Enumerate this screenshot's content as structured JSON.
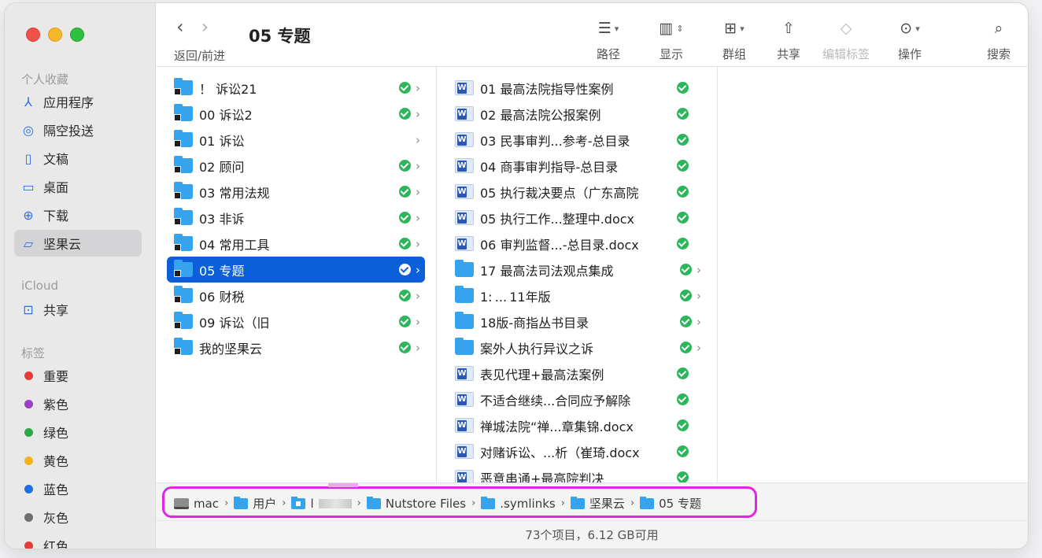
{
  "window": {
    "title": "05 专题",
    "nav_label": "返回/前进"
  },
  "sidebar": {
    "favorites_header": "个人收藏",
    "favorites": [
      {
        "label": "应用程序",
        "icon": "apps-icon"
      },
      {
        "label": "隔空投送",
        "icon": "airdrop-icon"
      },
      {
        "label": "文稿",
        "icon": "document-icon"
      },
      {
        "label": "桌面",
        "icon": "desktop-icon"
      },
      {
        "label": "下载",
        "icon": "download-icon"
      },
      {
        "label": "坚果云",
        "icon": "folder-icon",
        "selected": true
      }
    ],
    "icloud_header": "iCloud",
    "icloud": [
      {
        "label": "共享",
        "icon": "shared-folder-icon"
      }
    ],
    "tags_header": "标签",
    "tags": [
      {
        "label": "重要",
        "color": "#e63b3b"
      },
      {
        "label": "紫色",
        "color": "#9b3fc6"
      },
      {
        "label": "绿色",
        "color": "#2aa84a"
      },
      {
        "label": "黄色",
        "color": "#f1b21c"
      },
      {
        "label": "蓝色",
        "color": "#1e6fe3"
      },
      {
        "label": "灰色",
        "color": "#6e6e70"
      },
      {
        "label": "红色",
        "color": "#e63b3b"
      }
    ]
  },
  "toolbar": {
    "path": "路径",
    "view": "显示",
    "group": "群组",
    "share": "共享",
    "edit_tags": "编辑标签",
    "action": "操作",
    "search": "搜索"
  },
  "column1": [
    {
      "name": "！ 诉讼21",
      "synced": true
    },
    {
      "name": "00 诉讼2",
      "synced": true
    },
    {
      "name": "01 诉讼",
      "synced": false
    },
    {
      "name": "02 顾问",
      "synced": true
    },
    {
      "name": "03 常用法规",
      "synced": true
    },
    {
      "name": "03 非诉",
      "synced": true
    },
    {
      "name": "04 常用工具",
      "synced": true
    },
    {
      "name": "05 专题",
      "synced": true,
      "selected": true
    },
    {
      "name": "06 财税",
      "synced": true
    },
    {
      "name": "09 诉讼（旧",
      "synced": true
    },
    {
      "name": "我的坚果云",
      "synced": true
    }
  ],
  "column2": [
    {
      "name": "01 最高法院指导性案例",
      "kind": "doc"
    },
    {
      "name": "02 最高法院公报案例",
      "kind": "doc"
    },
    {
      "name": "03 民事审判...参考-总目录",
      "kind": "doc"
    },
    {
      "name": "04 商事审判指导-总目录",
      "kind": "doc"
    },
    {
      "name": "05 执行裁决要点（广东高院",
      "kind": "doc"
    },
    {
      "name": "05 执行工作...整理中.docx",
      "kind": "doc"
    },
    {
      "name": "06 审判监督...-总目录.docx",
      "kind": "doc"
    },
    {
      "name": "17 最高法司法观点集成",
      "kind": "folder"
    },
    {
      "name": "1: ... 11年版",
      "kind": "folder"
    },
    {
      "name": "18版-商指丛书目录",
      "kind": "folder"
    },
    {
      "name": "案外人执行异议之诉",
      "kind": "folder"
    },
    {
      "name": "表见代理+最高法案例",
      "kind": "doc"
    },
    {
      "name": "不适合继续...合同应予解除",
      "kind": "doc"
    },
    {
      "name": "禅城法院“禅...章集锦.docx",
      "kind": "doc"
    },
    {
      "name": "对赌诉讼、...析（崔琦.docx",
      "kind": "doc"
    },
    {
      "name": "恶意串通+最高院判决",
      "kind": "doc"
    }
  ],
  "pathbar": {
    "items": [
      {
        "label": "mac",
        "icon": "hard-drive-icon"
      },
      {
        "label": "用户",
        "icon": "folder-icon"
      },
      {
        "label": "l",
        "icon": "home-folder-icon",
        "blurred": true
      },
      {
        "label": "Nutstore Files",
        "icon": "folder-icon"
      },
      {
        "label": ".symlinks",
        "icon": "folder-icon"
      },
      {
        "label": "坚果云",
        "icon": "folder-icon"
      },
      {
        "label": "05 专题",
        "icon": "folder-icon"
      }
    ]
  },
  "status": {
    "text": "73个项目，6.12 GB可用"
  }
}
